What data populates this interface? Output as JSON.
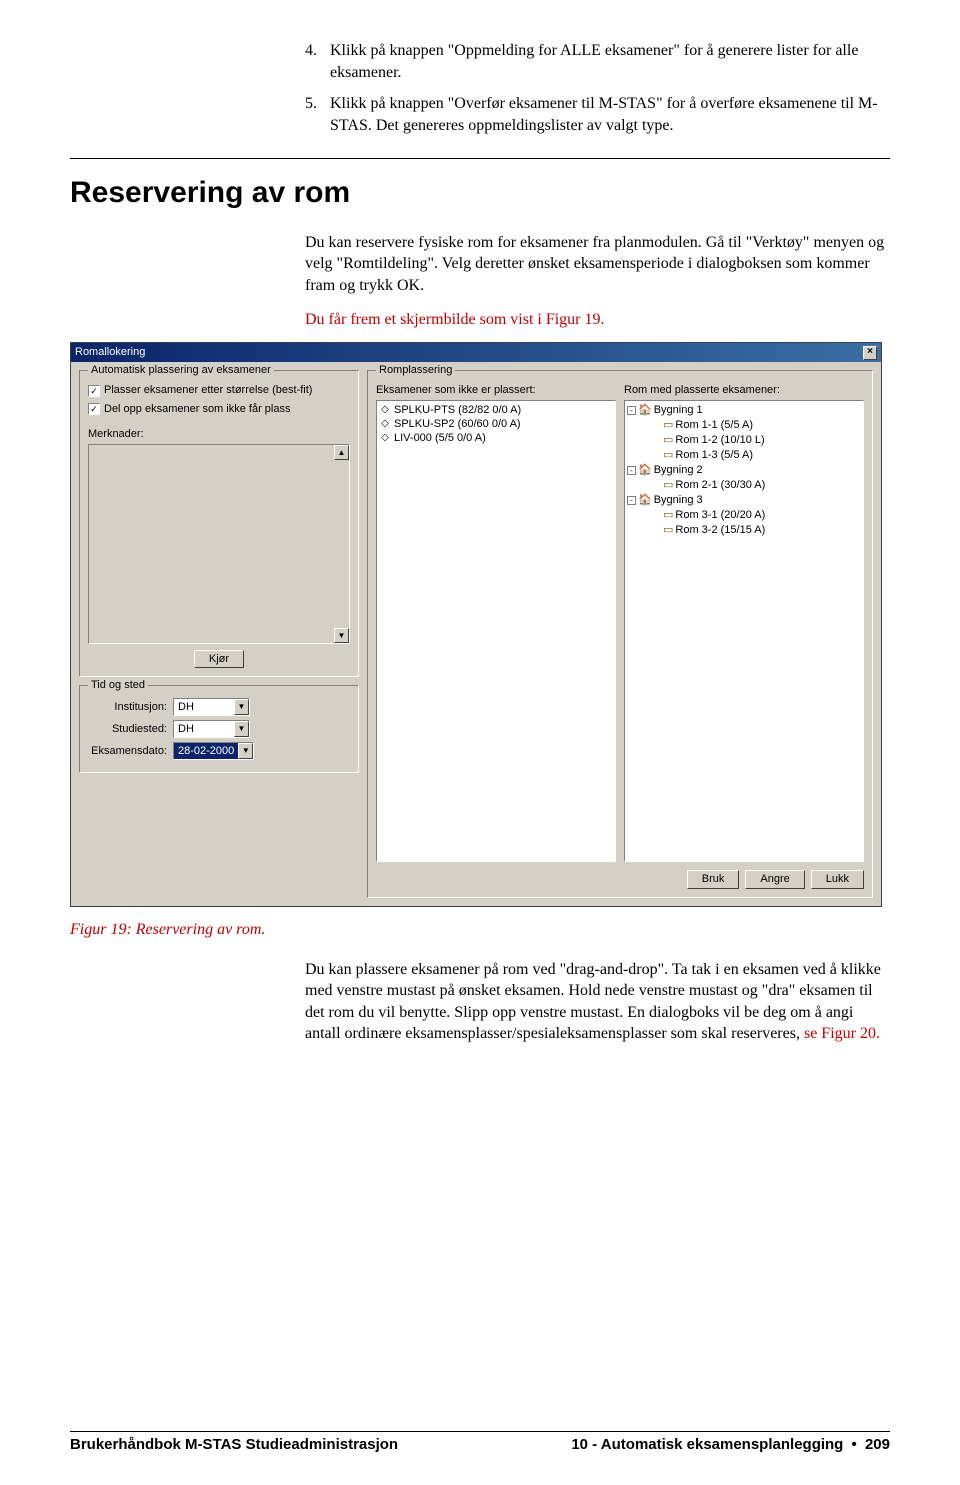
{
  "intro_list": [
    {
      "num": "4.",
      "text": "Klikk på knappen \"Oppmelding for ALLE eksamener\" for å generere lister for alle eksamener."
    },
    {
      "num": "5.",
      "text": "Klikk på knappen \"Overfør eksamener til M-STAS\" for å overføre eksamenene til M-STAS. Det genereres oppmeldingslister av valgt type."
    }
  ],
  "section_title": "Reservering av rom",
  "para1": "Du kan reservere fysiske rom for eksamener fra planmodulen. Gå til \"Verktøy\" menyen og velg \"Romtildeling\". Velg deretter ønsket eksamensperiode i dialogboksen som kommer fram og trykk OK.",
  "para2_red": "Du får frem et skjermbilde som vist i Figur 19.",
  "dialog": {
    "title": "Romallokering",
    "grp_auto": {
      "legend": "Automatisk plassering av eksamener",
      "check1": "Plasser eksamener etter størrelse (best-fit)",
      "check2": "Del opp eksamener som ikke får plass",
      "merk_label": "Merknader:",
      "run_btn": "Kjør"
    },
    "grp_tid": {
      "legend": "Tid og sted",
      "institusjon_lbl": "Institusjon:",
      "institusjon_val": "DH",
      "studiested_lbl": "Studiested:",
      "studiested_val": "DH",
      "dato_lbl": "Eksamensdato:",
      "dato_val": "28-02-2000"
    },
    "grp_rom": {
      "legend": "Romplassering",
      "left_lbl": "Eksamener som ikke er plassert:",
      "right_lbl": "Rom med plasserte eksamener:",
      "exams": [
        "SPLKU-PTS (82/82 0/0 A)",
        "SPLKU-SP2 (60/60 0/0 A)",
        "LIV-000 (5/5 0/0 A)"
      ],
      "tree": [
        {
          "exp": "-",
          "indent": 0,
          "icon": "b",
          "label": "Bygning 1"
        },
        {
          "exp": "",
          "indent": 2,
          "icon": "r",
          "label": "Rom 1-1 (5/5 A)"
        },
        {
          "exp": "",
          "indent": 2,
          "icon": "r",
          "label": "Rom 1-2 (10/10 L)"
        },
        {
          "exp": "",
          "indent": 2,
          "icon": "r",
          "label": "Rom 1-3 (5/5 A)"
        },
        {
          "exp": "-",
          "indent": 0,
          "icon": "b",
          "label": "Bygning 2"
        },
        {
          "exp": "",
          "indent": 2,
          "icon": "r",
          "label": "Rom 2-1 (30/30 A)"
        },
        {
          "exp": "-",
          "indent": 0,
          "icon": "b",
          "label": "Bygning 3"
        },
        {
          "exp": "",
          "indent": 2,
          "icon": "r",
          "label": "Rom 3-1 (20/20 A)"
        },
        {
          "exp": "",
          "indent": 2,
          "icon": "r",
          "label": "Rom 3-2 (15/15 A)"
        }
      ]
    },
    "footer": {
      "bruk": "Bruk",
      "angre": "Angre",
      "lukk": "Lukk"
    }
  },
  "fig_caption": "Figur 19: Reservering av rom.",
  "para3_a": "Du kan plassere eksamener på rom ved \"drag-and-drop\". Ta tak i en eksamen ved å klikke med venstre mustast på ønsket eksamen. Hold nede venstre mustast og \"dra\" eksamen til det rom du vil benytte. Slipp opp venstre mustast. En dialogboks vil be deg om å angi antall ordinære eksamensplasser/spesialeksamensplasser som skal reserveres, ",
  "para3_b_red": "se Figur 20.",
  "footer": {
    "left": "Brukerhåndbok M-STAS Studieadministrasjon",
    "right_a": "10 - Automatisk eksamensplanlegging",
    "right_b": "209"
  }
}
